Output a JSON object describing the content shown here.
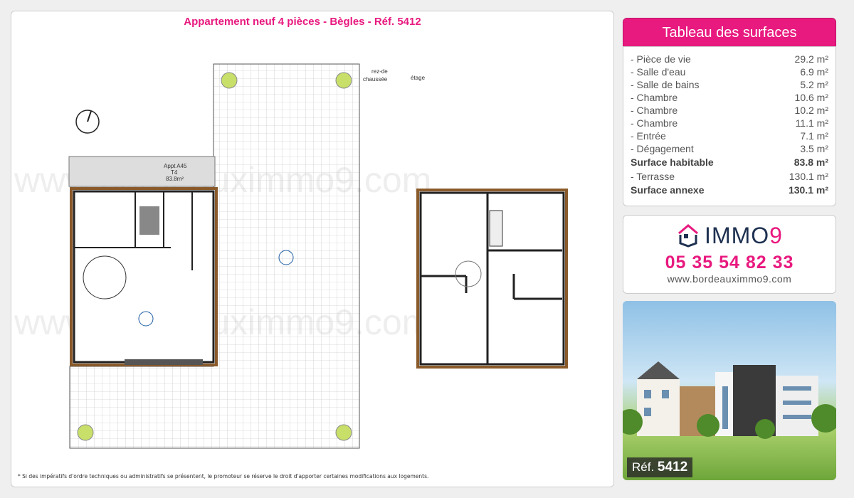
{
  "title": "Appartement neuf 4 pièces - Bègles - Réf. 5412",
  "plan": {
    "rdc": "rez-de chaussée",
    "rdc1": "rez-de",
    "rdc2": "chaussée",
    "etage": "étage",
    "appt": "Appt A45",
    "type": "T4",
    "area": "83.8m²",
    "watermark": "www.bordeauximmo9.com"
  },
  "footnote": "* Si des impératifs d'ordre techniques ou administratifs se présentent, le promoteur se réserve le droit d'apporter certaines modifications aux logements.",
  "surfaces": {
    "title": "Tableau des surfaces",
    "rows": [
      {
        "label": "- Pièce de vie",
        "value": "29.2 m²"
      },
      {
        "label": "- Salle d'eau",
        "value": "6.9 m²"
      },
      {
        "label": "- Salle de bains",
        "value": "5.2 m²"
      },
      {
        "label": "- Chambre",
        "value": "10.6 m²"
      },
      {
        "label": "- Chambre",
        "value": "10.2 m²"
      },
      {
        "label": "- Chambre",
        "value": "11.1 m²"
      },
      {
        "label": "- Entrée",
        "value": "7.1 m²"
      },
      {
        "label": "- Dégagement",
        "value": "3.5 m²"
      },
      {
        "label": "Surface habitable",
        "value": "83.8 m²",
        "bold": true
      },
      {
        "label": "- Terrasse",
        "value": "130.1 m²"
      },
      {
        "label": "Surface annexe",
        "value": "130.1 m²",
        "bold": true
      }
    ]
  },
  "agency": {
    "logo_text": "IMMO",
    "logo_digit": "9",
    "phone": "05 35 54 82 33",
    "website": "www.bordeauximmo9.com"
  },
  "photo": {
    "ref_label": "Réf.",
    "ref_number": "5412"
  },
  "colors": {
    "accent": "#e8197f",
    "navy": "#1d3050"
  }
}
